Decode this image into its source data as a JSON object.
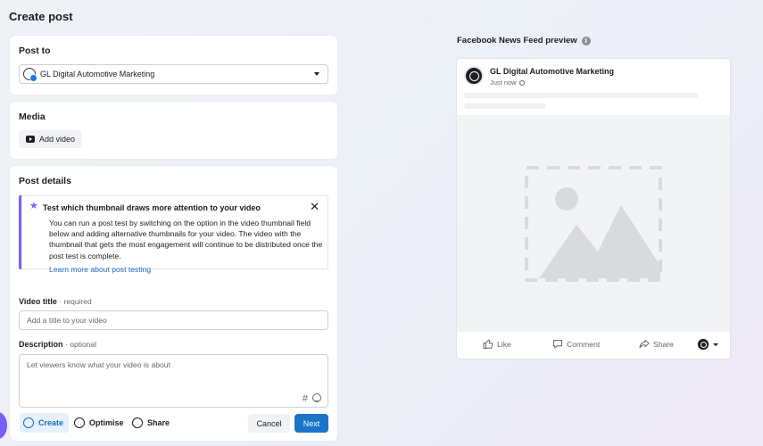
{
  "header": {
    "title": "Create post"
  },
  "post_to": {
    "title": "Post to",
    "selected_page": "GL Digital Automotive Marketing"
  },
  "media": {
    "title": "Media",
    "add_video_label": "Add video"
  },
  "details": {
    "title": "Post details",
    "notice": {
      "title": "Test which thumbnail draws more attention to your video",
      "body": "You can run a post test by switching on the option in the video thumbnail field below and adding alternative thumbnails for your video. The video with the thumbnail that gets the most engagement will continue to be distributed once the post test is complete.",
      "link": "Learn more about post testing"
    },
    "video_title": {
      "label": "Video title",
      "hint": "required",
      "placeholder": "Add a title to your video"
    },
    "description": {
      "label": "Description",
      "hint": "optional",
      "placeholder": "Let viewers know what your video is about",
      "hashtag_symbol": "#"
    }
  },
  "footer": {
    "steps": [
      "Create",
      "Optimise",
      "Share"
    ],
    "cancel_label": "Cancel",
    "next_label": "Next"
  },
  "preview": {
    "title": "Facebook News Feed preview",
    "info_symbol": "i",
    "page_name": "GL Digital Automotive Marketing",
    "timestamp": "Just now",
    "actions": {
      "like": "Like",
      "comment": "Comment",
      "share": "Share"
    }
  },
  "colors": {
    "accent": "#1b74c9",
    "notice_border": "#7b61ff",
    "link": "#1b6ec2"
  },
  "icons": [
    "page-avatar-icon",
    "dropdown-caret-icon",
    "video-icon",
    "star-icon",
    "close-icon",
    "hashtag-icon",
    "emoji-icon",
    "info-icon",
    "globe-icon",
    "image-placeholder-icon",
    "like-icon",
    "comment-icon",
    "share-icon"
  ]
}
